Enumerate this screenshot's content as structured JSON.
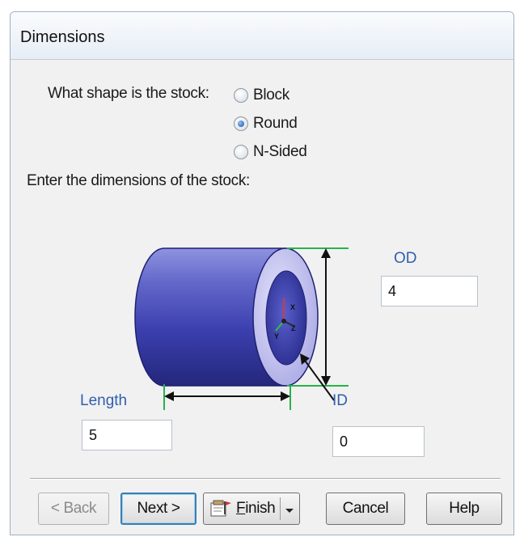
{
  "dialog": {
    "title": "Dimensions"
  },
  "shape": {
    "prompt": "What shape is the stock:",
    "options": [
      {
        "label": "Block",
        "selected": false
      },
      {
        "label": "Round",
        "selected": true
      },
      {
        "label": "N-Sided",
        "selected": false
      }
    ]
  },
  "dimensions_prompt": "Enter the dimensions of the stock:",
  "fields": {
    "od_label": "OD",
    "od_value": "4",
    "length_label": "Length",
    "length_value": "5",
    "id_label": "ID",
    "id_value": "0"
  },
  "axis_labels": {
    "x": "X",
    "y": "Y",
    "z": "Z"
  },
  "buttons": {
    "back": "< Back",
    "next": "Next >",
    "finish_prefix": "",
    "finish_underline": "F",
    "finish_rest": "inish",
    "cancel": "Cancel",
    "help": "Help"
  },
  "colors": {
    "cylinder_body": "#3b3fae",
    "cylinder_face": "#b9b8ec",
    "dimension_line": "#26b34a",
    "label_blue": "#2f5fae"
  }
}
